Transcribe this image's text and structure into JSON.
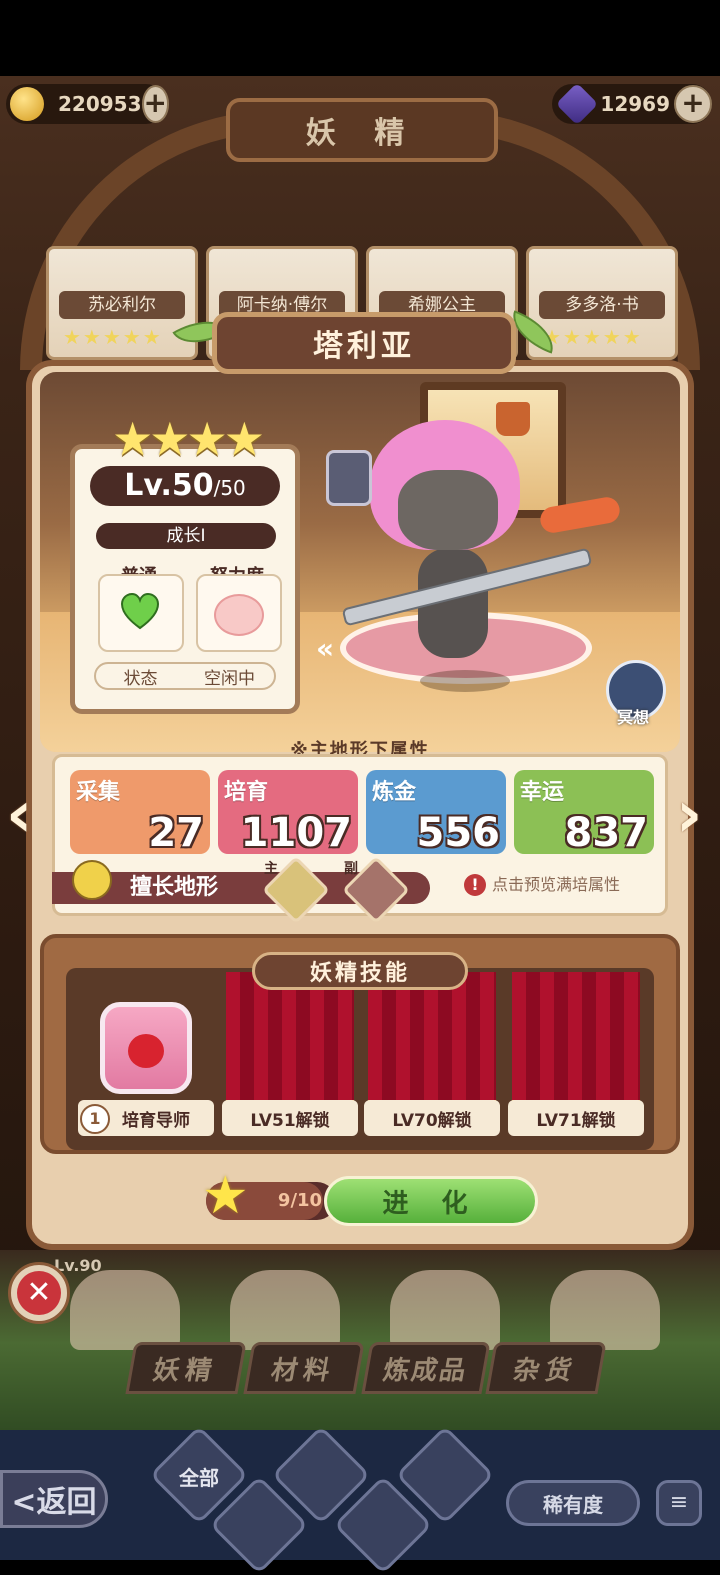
{
  "header": {
    "coins": "220953",
    "gems": "12969",
    "title": "妖 精"
  },
  "roster_cards": [
    {
      "name": "苏必利尔"
    },
    {
      "name": "阿卡纳·傅尔"
    },
    {
      "name": "希娜公主"
    },
    {
      "name": "多多洛·书"
    }
  ],
  "fairy": {
    "name": "塔利亚",
    "stars": "★★★★",
    "level": "Lv.50",
    "level_max": "/50",
    "growth": "成长I",
    "type_label": "普通",
    "effort_label": "努力度",
    "state_label": "状态",
    "state_value": "空闲中",
    "meditate_label": "冥想"
  },
  "attributes": {
    "title": "※主地形下属性",
    "items": [
      {
        "name": "采集",
        "value": "27",
        "color": "#ef9a6b"
      },
      {
        "name": "培育",
        "value": "1107",
        "color": "#e46b80"
      },
      {
        "name": "炼金",
        "value": "556",
        "color": "#5b9bd0"
      },
      {
        "name": "幸运",
        "value": "837",
        "color": "#8cc055"
      }
    ],
    "terrain_label": "擅长地形",
    "terrain_main_tag": "主",
    "terrain_sub_tag": "副",
    "preview_text": "点击预览满培属性"
  },
  "skills": {
    "title": "妖精技能",
    "slots": [
      {
        "label": "培育导师",
        "badge": "1"
      },
      {
        "label": "LV51解锁"
      },
      {
        "label": "LV70解锁"
      },
      {
        "label": "LV71解锁"
      }
    ]
  },
  "evolve": {
    "progress": "9/10",
    "progress_fraction": 0.9,
    "button_label": "进 化"
  },
  "bottom": {
    "level_peek": "Lv.90",
    "tabs": [
      "妖精",
      "材料",
      "炼成品",
      "杂货"
    ],
    "back_label": "<返回",
    "all_label": "全部",
    "rarity_label": "稀有度",
    "sort_icon": "≡"
  },
  "icons": [
    "coin-icon",
    "gem-icon",
    "plus-icon",
    "lock-icon",
    "heart-icon",
    "effort-face-icon",
    "meditate-icon",
    "bulb-icon",
    "close-icon",
    "star-icon",
    "tomato-icon",
    "sort-icon"
  ]
}
